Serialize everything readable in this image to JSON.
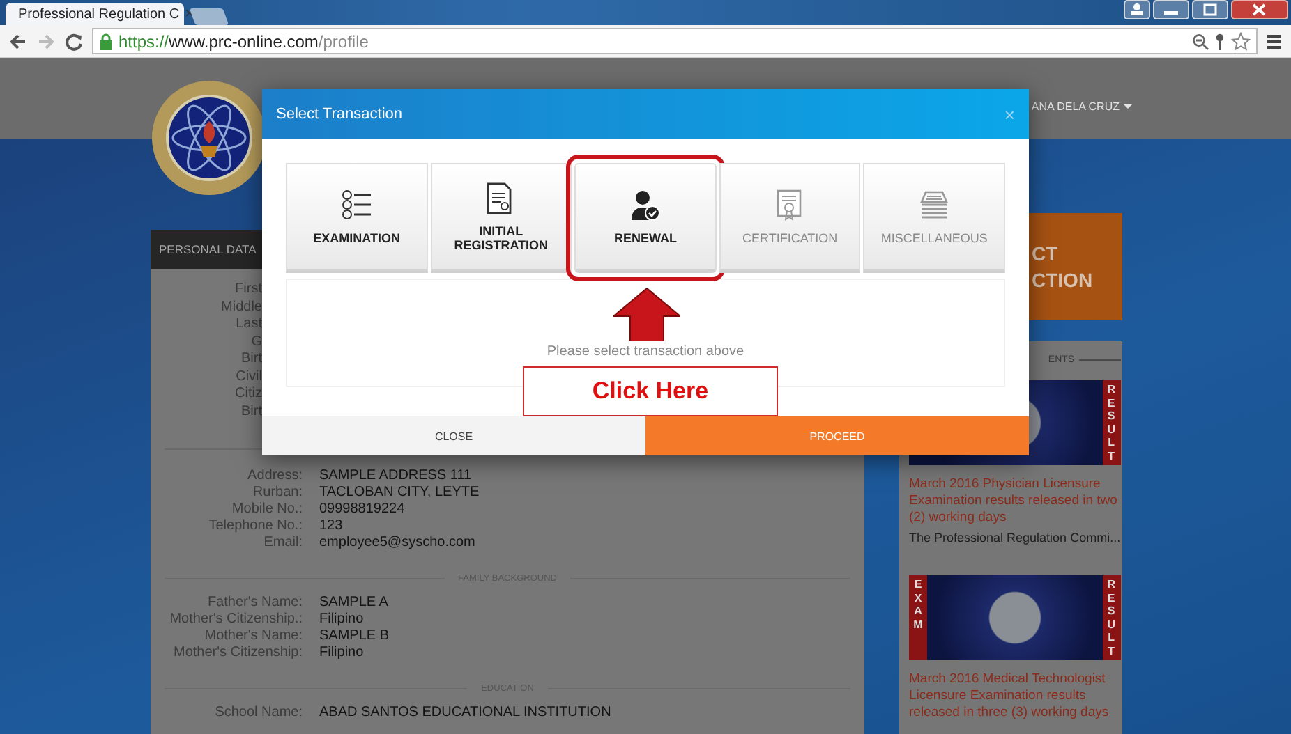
{
  "browser": {
    "tab_title": "Professional Regulation C",
    "tab_close": "×",
    "url": {
      "scheme": "https://",
      "host": "www.prc-online.com",
      "path": "/profile"
    }
  },
  "header": {
    "user_name": "ANA DELA CRUZ"
  },
  "personal_data": {
    "title": "PERSONAL DATA",
    "covered_labels": [
      "First",
      "Middle",
      "Last",
      "G",
      "Birt",
      "Civil",
      "Citiz",
      "Birt"
    ],
    "contact": [
      {
        "label": "Address:",
        "value": "SAMPLE ADDRESS 111"
      },
      {
        "label": "Rurban:",
        "value": "TACLOBAN CITY, LEYTE"
      },
      {
        "label": "Mobile No.:",
        "value": "09998819224"
      },
      {
        "label": "Telephone No.:",
        "value": "123"
      },
      {
        "label": "Email:",
        "value": "employee5@syscho.com"
      }
    ],
    "sections": [
      {
        "title": "FAMILY BACKGROUND",
        "rows": [
          {
            "label": "Father's Name:",
            "value": "SAMPLE A"
          },
          {
            "label": "Mother's Citizenship.:",
            "value": "Filipino"
          },
          {
            "label": "Mother's Name:",
            "value": "SAMPLE B"
          },
          {
            "label": "Mother's Citizenship:",
            "value": "Filipino"
          }
        ]
      },
      {
        "title": "EDUCATION",
        "rows": [
          {
            "label": "School Name:",
            "value": "ABAD SANTOS EDUCATIONAL INSTITUTION"
          }
        ]
      }
    ]
  },
  "select_transaction": {
    "lines": [
      "CT",
      "CTION"
    ]
  },
  "announcements": {
    "heading": "ENTS",
    "items": [
      {
        "badges": [
          {
            "kind": "right",
            "text": "RESULT"
          }
        ],
        "title": "March 2016 Physician Licensure Examination results released in two (2) working days",
        "excerpt": "The Professional Regulation Commi..."
      },
      {
        "badges": [
          {
            "kind": "left",
            "text": "EXAM"
          },
          {
            "kind": "right",
            "text": "RESULT"
          }
        ],
        "title": "March 2016 Medical Technologist Licensure Examination results released in three (3) working days"
      }
    ]
  },
  "modal": {
    "title": "Select Transaction",
    "close": "×",
    "tiles": [
      {
        "label": "EXAMINATION",
        "kind": "checklist",
        "selected": false,
        "disabled": false
      },
      {
        "label": "INITIAL REGISTRATION",
        "kind": "document",
        "selected": false,
        "disabled": false
      },
      {
        "label": "RENEWAL",
        "kind": "user",
        "selected": true,
        "disabled": false
      },
      {
        "label": "CERTIFICATION",
        "kind": "certificate",
        "selected": false,
        "disabled": true
      },
      {
        "label": "MISCELLANEOUS",
        "kind": "tray",
        "selected": false,
        "disabled": true
      }
    ],
    "message": "Please select transaction above",
    "buttons": [
      {
        "label": "CLOSE",
        "kind": "secondary"
      },
      {
        "label": "PROCEED",
        "kind": "primary"
      }
    ]
  },
  "callout": {
    "text": "Click Here"
  }
}
